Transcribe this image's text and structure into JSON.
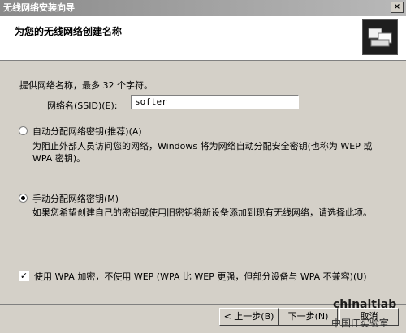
{
  "window": {
    "title": "无线网络安装向导",
    "close_glyph": "×"
  },
  "header": {
    "title": "为您的无线网络创建名称"
  },
  "form": {
    "prompt": "提供网络名称，最多 32 个字符。",
    "ssid_label": "网络名(SSID)(E):",
    "ssid_value": "softer"
  },
  "options": [
    {
      "label": "自动分配网络密钥(推荐)(A)",
      "description": "为阻止外部人员访问您的网络，Windows 将为网络自动分配安全密钥(也称为 WEP 或 WPA 密钥)。",
      "selected": false
    },
    {
      "label": "手动分配网络密钥(M)",
      "description": "如果您希望创建自己的密钥或使用旧密钥将新设备添加到现有无线网络，请选择此项。",
      "selected": true
    }
  ],
  "wpa": {
    "label": "使用 WPA 加密，不使用 WEP (WPA 比 WEP 更强，但部分设备与 WPA 不兼容)(U)",
    "checked": true,
    "check_glyph": "✓"
  },
  "buttons": {
    "back": "< 上一步(B)",
    "next": "下一步(N)",
    "cancel": "取消"
  },
  "watermark": {
    "brand": "chinaitlab",
    "sub": "中国IT实验室"
  }
}
